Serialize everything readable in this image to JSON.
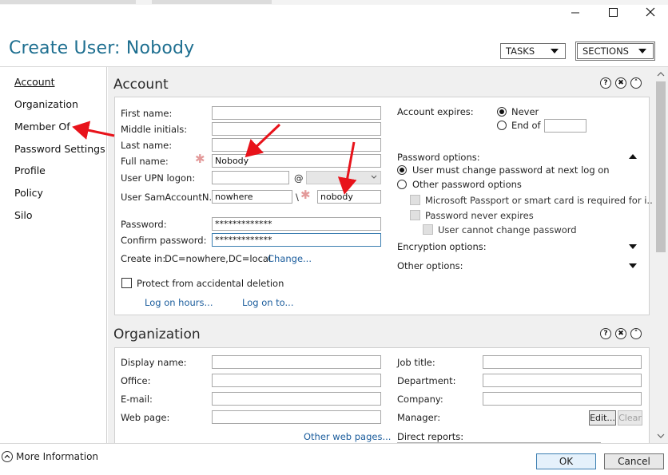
{
  "window": {
    "title": "Create User: Nobody"
  },
  "header": {
    "tasks_label": "TASKS",
    "sections_label": "SECTIONS"
  },
  "nav": {
    "items": [
      {
        "label": "Account"
      },
      {
        "label": "Organization"
      },
      {
        "label": "Member Of"
      },
      {
        "label": "Password Settings"
      },
      {
        "label": "Profile"
      },
      {
        "label": "Policy"
      },
      {
        "label": "Silo"
      }
    ]
  },
  "account": {
    "heading": "Account",
    "first_name_label": "First name:",
    "first_name_value": "",
    "middle_initials_label": "Middle initials:",
    "middle_initials_value": "",
    "last_name_label": "Last name:",
    "last_name_value": "",
    "full_name_label": "Full name:",
    "full_name_value": "Nobody",
    "upn_label": "User UPN logon:",
    "upn_value": "",
    "at_sign": "@",
    "sam_label": "User SamAccountN...",
    "sam_domain_value": "nowhere",
    "sam_sep": "\\",
    "sam_user_value": "nobody",
    "password_label": "Password:",
    "password_value": "*************",
    "confirm_label": "Confirm password:",
    "confirm_value": "*************",
    "create_in_label": "Create in:",
    "create_in_value": "DC=nowhere,DC=local",
    "change_link": "Change...",
    "protect_label": "Protect from accidental deletion",
    "protect_checked": false,
    "logon_hours_link": "Log on hours...",
    "logon_to_link": "Log on to...",
    "account_expires_label": "Account expires:",
    "never_label": "Never",
    "end_of_label": "End of",
    "end_of_value": "",
    "expires_selected": "Never",
    "password_options_label": "Password options:",
    "must_change_label": "User must change password at next log on",
    "other_pw_label": "Other password options",
    "pw_option_selected": "must_change",
    "passport_label": "Microsoft Passport or smart card is required for i...",
    "never_expires_label": "Password never expires",
    "cannot_change_label": "User cannot change password",
    "encryption_label": "Encryption options:",
    "other_options_label": "Other options:"
  },
  "organization": {
    "heading": "Organization",
    "display_name_label": "Display name:",
    "office_label": "Office:",
    "email_label": "E-mail:",
    "web_page_label": "Web page:",
    "other_web_link": "Other web pages...",
    "job_title_label": "Job title:",
    "department_label": "Department:",
    "company_label": "Company:",
    "manager_label": "Manager:",
    "edit_label": "Edit...",
    "clear_label": "Clear",
    "direct_reports_label": "Direct reports:"
  },
  "footer": {
    "more_info": "More Information",
    "ok": "OK",
    "cancel": "Cancel"
  },
  "icons": {
    "help": "?",
    "close": "✖",
    "collapse": "˄"
  },
  "colors": {
    "title": "#1e6f90",
    "link": "#1a5c9c",
    "annotation_arrow": "#e8131b",
    "required_star": "#e39a9a"
  }
}
